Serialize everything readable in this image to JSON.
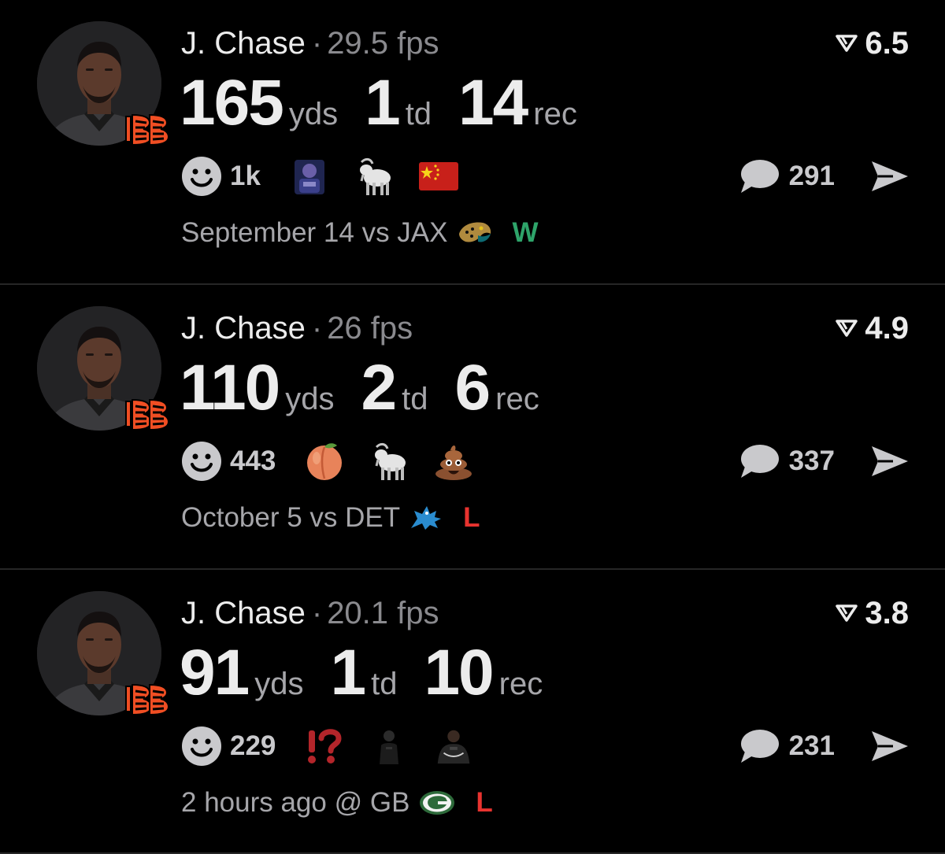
{
  "colors": {
    "background": "#000000",
    "win": "#2ea46a",
    "loss": "#e8332f",
    "muted": "#8a8a8e",
    "bengals_orange": "#f04e23"
  },
  "posts": [
    {
      "player": "J. Chase",
      "fps": "29.5 fps",
      "rating": "6.5",
      "team_icon": "bengals-logo-icon",
      "stats": [
        {
          "value": "165",
          "unit": "yds"
        },
        {
          "value": "1",
          "unit": "td"
        },
        {
          "value": "14",
          "unit": "rec"
        }
      ],
      "reaction_count": "1k",
      "reactions": [
        "character-image-icon",
        "goat-icon",
        "china-flag-icon"
      ],
      "comment_count": "291",
      "game": "September 14 vs JAX",
      "opponent_icon": "jaguars-logo-icon",
      "result": "W",
      "result_color": "#2ea46a"
    },
    {
      "player": "J. Chase",
      "fps": "26 fps",
      "rating": "4.9",
      "team_icon": "bengals-logo-icon",
      "stats": [
        {
          "value": "110",
          "unit": "yds"
        },
        {
          "value": "2",
          "unit": "td"
        },
        {
          "value": "6",
          "unit": "rec"
        }
      ],
      "reaction_count": "443",
      "reactions": [
        "peach-icon",
        "goat-icon",
        "poop-icon"
      ],
      "comment_count": "337",
      "game": "October 5 vs DET",
      "opponent_icon": "lions-logo-icon",
      "result": "L",
      "result_color": "#e8332f"
    },
    {
      "player": "J. Chase",
      "fps": "20.1 fps",
      "rating": "3.8",
      "team_icon": "bengals-logo-icon",
      "stats": [
        {
          "value": "91",
          "unit": "yds"
        },
        {
          "value": "1",
          "unit": "td"
        },
        {
          "value": "10",
          "unit": "rec"
        }
      ],
      "reaction_count": "229",
      "reactions": [
        "interrobang-icon",
        "person-image-icon",
        "brooklyn-player-image-icon"
      ],
      "comment_count": "231",
      "game": "2 hours ago @ GB",
      "opponent_icon": "packers-logo-icon",
      "result": "L",
      "result_color": "#e8332f"
    }
  ]
}
